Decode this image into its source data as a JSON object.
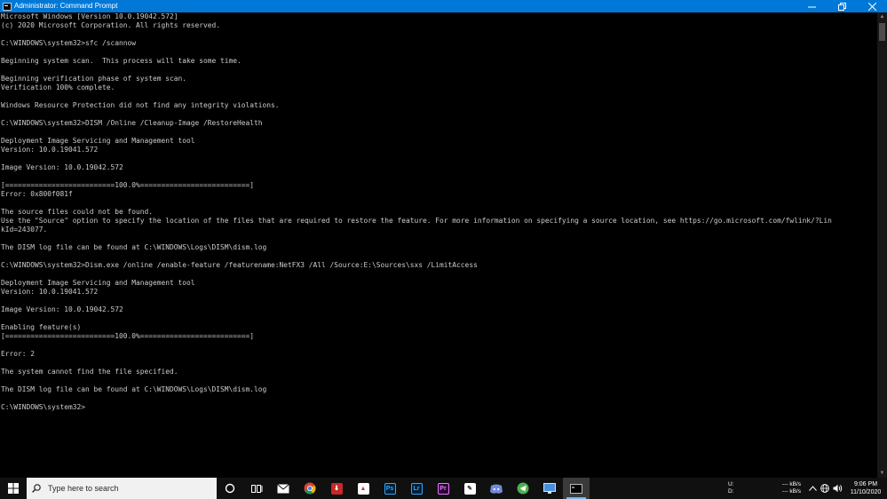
{
  "window": {
    "title": "Administrator: Command Prompt",
    "controls": {
      "minimize": "—",
      "maximize": "□",
      "close": "✕"
    }
  },
  "console": {
    "lines": [
      "Microsoft Windows [Version 10.0.19042.572]",
      "(c) 2020 Microsoft Corporation. All rights reserved.",
      "",
      "C:\\WINDOWS\\system32>sfc /scannow",
      "",
      "Beginning system scan.  This process will take some time.",
      "",
      "Beginning verification phase of system scan.",
      "Verification 100% complete.",
      "",
      "Windows Resource Protection did not find any integrity violations.",
      "",
      "C:\\WINDOWS\\system32>DISM /Online /Cleanup-Image /RestoreHealth",
      "",
      "Deployment Image Servicing and Management tool",
      "Version: 10.0.19041.572",
      "",
      "Image Version: 10.0.19042.572",
      "",
      "[==========================100.0%==========================]",
      "Error: 0x800f081f",
      "",
      "The source files could not be found.",
      "Use the \"Source\" option to specify the location of the files that are required to restore the feature. For more information on specifying a source location, see https://go.microsoft.com/fwlink/?Lin",
      "kId=243077.",
      "",
      "The DISM log file can be found at C:\\WINDOWS\\Logs\\DISM\\dism.log",
      "",
      "C:\\WINDOWS\\system32>Dism.exe /online /enable-feature /featurename:NetFX3 /All /Source:E:\\Sources\\sxs /LimitAccess",
      "",
      "Deployment Image Servicing and Management tool",
      "Version: 10.0.19041.572",
      "",
      "Image Version: 10.0.19042.572",
      "",
      "Enabling feature(s)",
      "[==========================100.0%==========================]",
      "",
      "Error: 2",
      "",
      "The system cannot find the file specified.",
      "",
      "The DISM log file can be found at C:\\WINDOWS\\Logs\\DISM\\dism.log",
      "",
      "C:\\WINDOWS\\system32>"
    ]
  },
  "taskbar": {
    "search_placeholder": "Type here to search",
    "apps": [
      {
        "name": "cortana-icon"
      },
      {
        "name": "task-view-icon"
      },
      {
        "name": "mail-icon"
      },
      {
        "name": "chrome-icon"
      },
      {
        "name": "downloader-icon"
      },
      {
        "name": "acrobat-icon"
      },
      {
        "name": "photoshop-icon",
        "label": "Ps"
      },
      {
        "name": "lightroom-icon",
        "label": "Lr"
      },
      {
        "name": "premiere-icon",
        "label": "Pr"
      },
      {
        "name": "notes-icon"
      },
      {
        "name": "discord-icon"
      },
      {
        "name": "telegram-icon"
      },
      {
        "name": "remote-desktop-icon"
      },
      {
        "name": "command-prompt-icon",
        "active": true
      }
    ],
    "tray": {
      "drive_u": "U:",
      "drive_d": "D:",
      "upload_speed": "--- kB/s",
      "download_speed": "--- kB/s",
      "time": "9:06 PM",
      "date": "11/10/2020"
    }
  },
  "colors": {
    "titlebar": "#0078d7",
    "console_bg": "#000000",
    "console_text": "#cccccc",
    "taskbar_bg": "#101010"
  }
}
